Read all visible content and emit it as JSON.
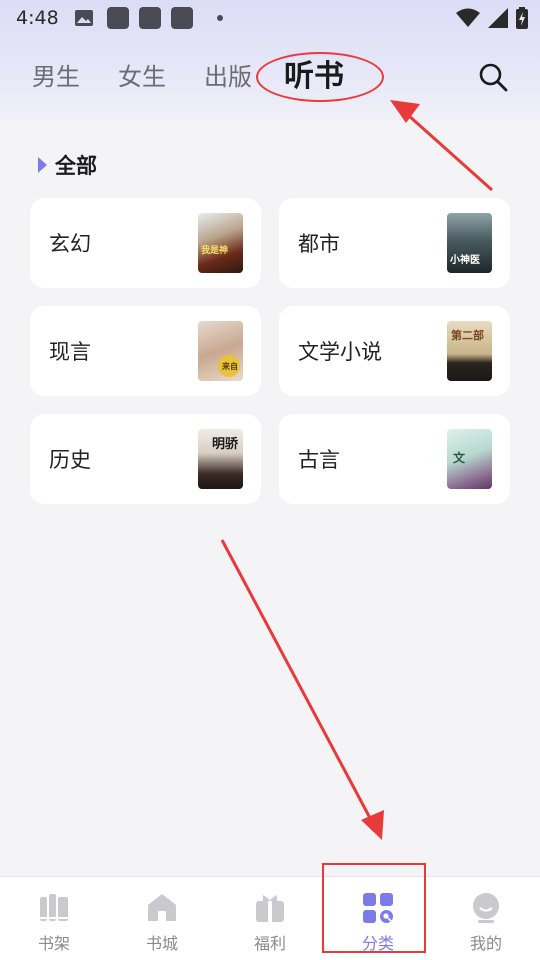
{
  "status_bar": {
    "time": "4:48"
  },
  "top_tabs": [
    {
      "label": "男生",
      "active": false
    },
    {
      "label": "女生",
      "active": false
    },
    {
      "label": "出版",
      "active": false
    },
    {
      "label": "听书",
      "active": true
    }
  ],
  "search": {
    "icon": "search-icon"
  },
  "section": {
    "title": "全部"
  },
  "categories": [
    {
      "label": "玄幻",
      "cover_text": "我是神"
    },
    {
      "label": "都市",
      "cover_text": "小神医"
    },
    {
      "label": "现言",
      "cover_text": "来自"
    },
    {
      "label": "文学小说",
      "cover_text": "第二部"
    },
    {
      "label": "历史",
      "cover_text": "明骄"
    },
    {
      "label": "古言",
      "cover_text": "文"
    }
  ],
  "bottom_nav": [
    {
      "label": "书架",
      "icon": "bookshelf-icon",
      "active": false
    },
    {
      "label": "书城",
      "icon": "bookstore-icon",
      "active": false
    },
    {
      "label": "福利",
      "icon": "gift-icon",
      "active": false
    },
    {
      "label": "分类",
      "icon": "category-icon",
      "active": true
    },
    {
      "label": "我的",
      "icon": "profile-icon",
      "active": false
    }
  ],
  "colors": {
    "accent": "#7b7bea",
    "annotation": "#e83a3a",
    "background": "#f4f4f6"
  }
}
